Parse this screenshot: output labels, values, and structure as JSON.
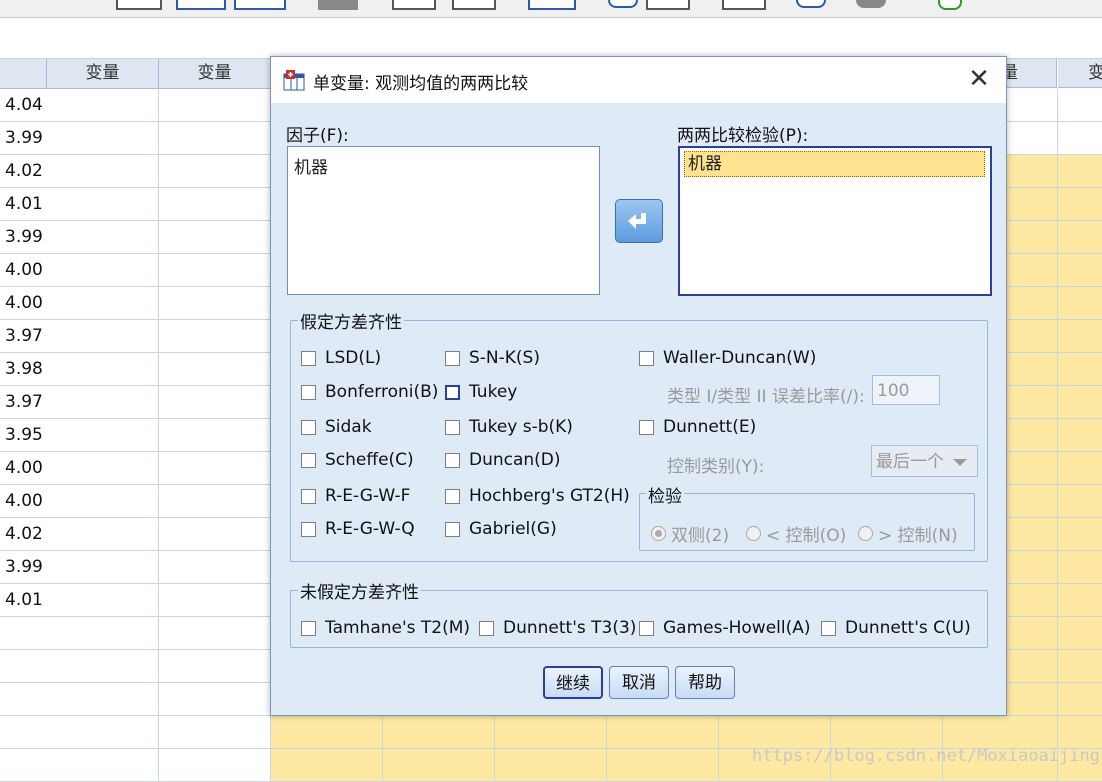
{
  "grid": {
    "headers": [
      "变量",
      "变量",
      "量",
      "变"
    ],
    "values": [
      "4.04",
      "3.99",
      "4.02",
      "4.01",
      "3.99",
      "4.00",
      "4.00",
      "3.97",
      "3.98",
      "3.97",
      "3.95",
      "4.00",
      "4.00",
      "4.02",
      "3.99",
      "4.01"
    ]
  },
  "dialog": {
    "title": "单变量: 观测均值的两两比较",
    "close_label": "✕",
    "factors_label": "因子(F):",
    "factors": [
      "机器"
    ],
    "posthoc_label": "两两比较检验(P):",
    "posthoc": [
      "机器"
    ],
    "equal_var": {
      "title": "假定方差齐性",
      "lsd": "LSD(L)",
      "bonferroni": "Bonferroni(B)",
      "sidak": "Sidak",
      "scheffe": "Scheffe(C)",
      "regwf": "R-E-G-W-F",
      "regwq": "R-E-G-W-Q",
      "snk": "S-N-K(S)",
      "tukey": "Tukey",
      "tukeyb": "Tukey s-b(K)",
      "duncan": "Duncan(D)",
      "hochberg": "Hochberg's GT2(H)",
      "gabriel": "Gabriel(G)",
      "waller": "Waller-Duncan(W)",
      "ratio_label": "类型 I/类型 II 误差比率(/):",
      "ratio_value": "100",
      "dunnett": "Dunnett(E)",
      "control_label": "控制类别(Y):",
      "control_value": "最后一个",
      "test_title": "检验",
      "two_sided": "双侧(2)",
      "lt_control": "< 控制(O)",
      "gt_control": "> 控制(N)"
    },
    "unequal_var": {
      "title": "未假定方差齐性",
      "t2": "Tamhane's T2(M)",
      "t3": "Dunnett's T3(3)",
      "gh": "Games-Howell(A)",
      "c": "Dunnett's C(U)"
    },
    "buttons": {
      "continue": "继续",
      "cancel": "取消",
      "help": "帮助"
    }
  },
  "watermark": "https://blog.csdn.net/Moxiaoaijing"
}
